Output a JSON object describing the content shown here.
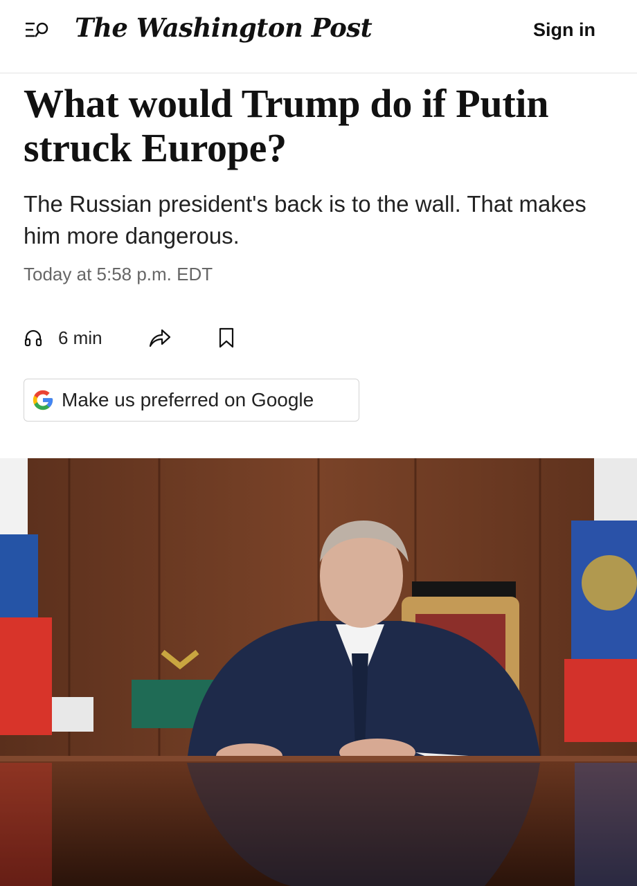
{
  "header": {
    "masthead": "The Washington Post",
    "sign_in_label": "Sign in",
    "menu_icon": "menu-search-icon"
  },
  "article": {
    "headline": "What would Trump do if Putin struck Europe?",
    "dek": "The Russian president's back is to the wall. That makes him more dangerous.",
    "timestamp": "Today at 5:58 p.m. EDT",
    "listen_duration": "6 min",
    "listen_icon": "headphones-icon",
    "share_icon": "share-icon",
    "bookmark_icon": "bookmark-icon",
    "google_button_label": "Make us preferred on Google",
    "google_icon": "google-g-icon"
  },
  "colors": {
    "google_blue": "#4285F4",
    "google_red": "#EA4335",
    "google_yellow": "#FBBC05",
    "google_green": "#34A853"
  }
}
